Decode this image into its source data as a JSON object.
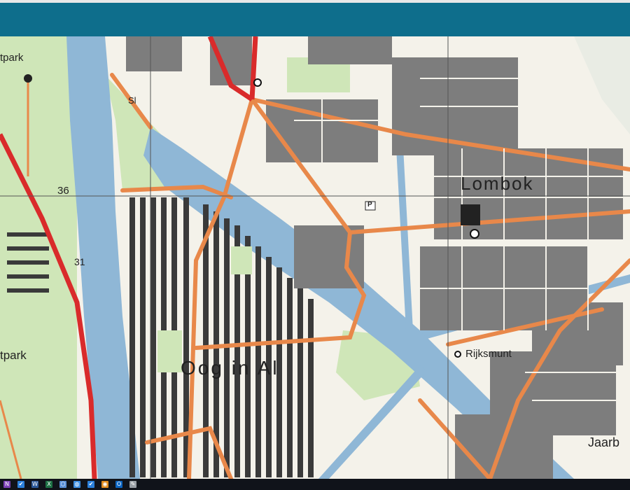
{
  "map": {
    "labels": {
      "lombok": "Lombok",
      "oog_in_al": "Oog in Al",
      "rijksmunt": "Rijksmunt",
      "jaarb": "Jaarb",
      "park_top": "tpark",
      "park_bottom": "tpark",
      "grid_36": "36",
      "grid_31": "31",
      "sl": "Sl",
      "parking": "P"
    },
    "colors": {
      "header": "#0e6e8c",
      "water": "#8fb7d6",
      "green": "#cfe6b8",
      "road_orange": "#e8884a",
      "road_red": "#d92b2b",
      "building": "#7d7d7d",
      "paper": "#f4f2ea"
    }
  },
  "taskbar": {
    "icons": [
      {
        "name": "onenote-icon",
        "glyph": "N",
        "color": "#7b3fb5"
      },
      {
        "name": "check-icon",
        "glyph": "✔",
        "color": "#2b7fd9"
      },
      {
        "name": "word-icon",
        "glyph": "W",
        "color": "#2b5797"
      },
      {
        "name": "excel-icon",
        "glyph": "X",
        "color": "#1e7145"
      },
      {
        "name": "network-icon",
        "glyph": "⬡",
        "color": "#5a8fd6"
      },
      {
        "name": "globe-icon",
        "glyph": "◍",
        "color": "#3c8de0"
      },
      {
        "name": "check-icon-2",
        "glyph": "✔",
        "color": "#2b7fd9"
      },
      {
        "name": "media-icon",
        "glyph": "◉",
        "color": "#e08a1e"
      },
      {
        "name": "outlook-icon",
        "glyph": "O",
        "color": "#0b64c0"
      },
      {
        "name": "tools-icon",
        "glyph": "✎",
        "color": "#9aa0a6"
      }
    ]
  }
}
